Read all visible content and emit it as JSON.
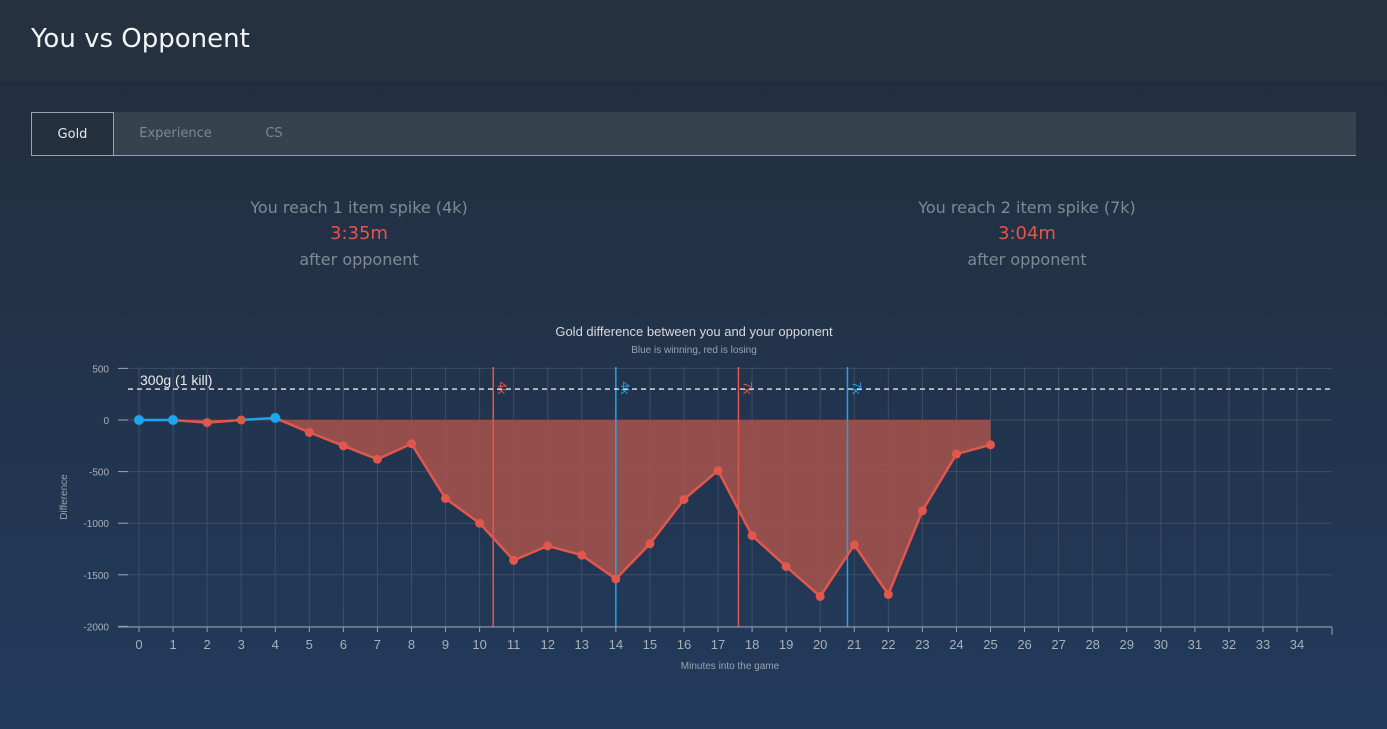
{
  "header": {
    "title": "You vs Opponent"
  },
  "tabs": [
    {
      "label": "Gold",
      "active": true
    },
    {
      "label": "Experience",
      "active": false
    },
    {
      "label": "CS",
      "active": false
    }
  ],
  "spikes": [
    {
      "label": "You reach 1 item spike (4k)",
      "time": "3:35m",
      "after": "after opponent"
    },
    {
      "label": "You reach 2 item spike (7k)",
      "time": "3:04m",
      "after": "after opponent"
    }
  ],
  "colors": {
    "winning": "#1ba6f0",
    "losing": "#e2574c",
    "fill": "#a8524b"
  },
  "chart_data": {
    "type": "area",
    "title": "Gold difference between you and your opponent",
    "subtitle": "Blue is winning, red is losing",
    "xlabel": "Minutes into the game",
    "ylabel": "Difference",
    "xlim": [
      0,
      34
    ],
    "ylim": [
      -2000,
      500
    ],
    "x_ticks": [
      0,
      1,
      2,
      3,
      4,
      5,
      6,
      7,
      8,
      9,
      10,
      11,
      12,
      13,
      14,
      15,
      16,
      17,
      18,
      19,
      20,
      21,
      22,
      23,
      24,
      25,
      26,
      27,
      28,
      29,
      30,
      31,
      32,
      33,
      34
    ],
    "y_ticks": [
      500,
      0,
      -500,
      -1000,
      -1500,
      -2000
    ],
    "grid": true,
    "series": [
      {
        "x": [
          0,
          1,
          2,
          3,
          4,
          5,
          6,
          7,
          8,
          9,
          10,
          11,
          12,
          13,
          14,
          15,
          16,
          17,
          18,
          19,
          20,
          21,
          22,
          23,
          24,
          25
        ],
        "values": [
          0,
          0,
          -25,
          0,
          20,
          -120,
          -250,
          -380,
          -230,
          -760,
          -1000,
          -1360,
          -1220,
          -1310,
          -1540,
          -1200,
          -770,
          -490,
          -1120,
          -1420,
          -1710,
          -1210,
          -1690,
          -880,
          -330,
          -240
        ]
      }
    ],
    "reference_line": {
      "y": 300,
      "label": "300g (1 kill)"
    },
    "markers": [
      {
        "x": 10.4,
        "label": "4k",
        "who": "losing"
      },
      {
        "x": 14.0,
        "label": "4k",
        "who": "winning"
      },
      {
        "x": 17.6,
        "label": "7k",
        "who": "losing"
      },
      {
        "x": 20.8,
        "label": "7k",
        "who": "winning"
      }
    ]
  }
}
